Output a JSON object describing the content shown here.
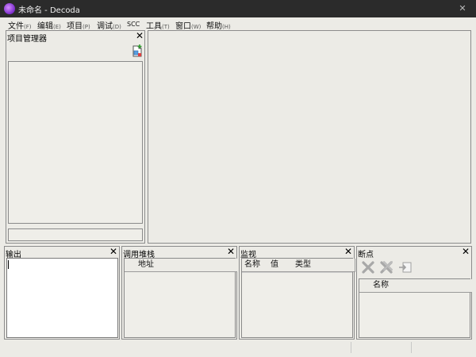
{
  "window": {
    "title": "未命名 - Decoda",
    "close_glyph": "✕"
  },
  "menu": [
    {
      "label": "文件",
      "accel": "(F)"
    },
    {
      "label": "编辑",
      "accel": "(E)"
    },
    {
      "label": "项目",
      "accel": "(P)"
    },
    {
      "label": "调试",
      "accel": "(D)"
    },
    {
      "label": "SCC",
      "accel": ""
    },
    {
      "label": "工具",
      "accel": "(T)"
    },
    {
      "label": "窗口",
      "accel": "(W)"
    },
    {
      "label": "帮助",
      "accel": "(H)"
    }
  ],
  "project_panel": {
    "title": "项目管理器",
    "close": "✕"
  },
  "output_panel": {
    "title": "输出",
    "close": "✕"
  },
  "callstack_panel": {
    "title": "调用堆栈",
    "close": "✕",
    "columns": [
      "",
      "地址"
    ]
  },
  "watch_panel": {
    "title": "监视",
    "close": "✕",
    "columns": [
      "名称",
      "值",
      "类型"
    ]
  },
  "breakpoints_panel": {
    "title": "断点",
    "close": "✕",
    "columns": [
      "",
      "名称"
    ]
  },
  "colors": {
    "titlebar": "#2b2b2b",
    "background": "#ecebe6",
    "border": "#8c8c8c"
  }
}
